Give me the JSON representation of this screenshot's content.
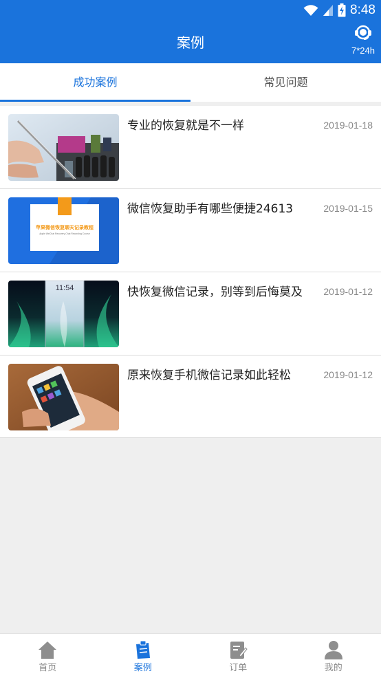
{
  "status": {
    "time": "8:48"
  },
  "header": {
    "title": "案例",
    "service_label": "7*24h"
  },
  "tabs": [
    {
      "label": "成功案例",
      "active": true
    },
    {
      "label": "常见问题",
      "active": false
    }
  ],
  "cases": [
    {
      "title": "专业的恢复就是不一样",
      "date": "2019-01-18",
      "thumb": "circuit-board-photo"
    },
    {
      "title": "微信恢复助手有哪些便捷24613",
      "date": "2019-01-15",
      "thumb": "tutorial-banner",
      "thumb_text": "苹果微信恢复聊天记录教程",
      "thumb_subtext": "Apple WeChat Recovery Chat Recording Course"
    },
    {
      "title": "快恢复微信记录，别等到后悔莫及",
      "date": "2019-01-12",
      "thumb": "aurora-phone-screens",
      "thumb_time": "11:54"
    },
    {
      "title": "原来恢复手机微信记录如此轻松",
      "date": "2019-01-12",
      "thumb": "hand-holding-phone"
    }
  ],
  "bottom_nav": [
    {
      "label": "首页",
      "icon": "home-icon",
      "active": false
    },
    {
      "label": "案例",
      "icon": "case-icon",
      "active": true
    },
    {
      "label": "订单",
      "icon": "order-icon",
      "active": false
    },
    {
      "label": "我的",
      "icon": "profile-icon",
      "active": false
    }
  ],
  "colors": {
    "primary": "#1a73dc",
    "text": "#222222",
    "muted": "#888888",
    "background": "#efefef"
  }
}
